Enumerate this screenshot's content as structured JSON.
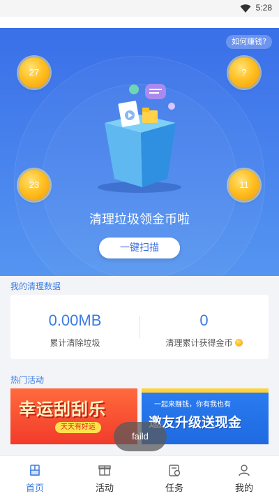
{
  "status_bar": {
    "time": "5:28"
  },
  "hero": {
    "how_to_earn": "如何赚钱?",
    "coins": [
      "27",
      "?",
      "23",
      "11"
    ],
    "title": "清理垃圾领金币啦",
    "scan_button": "一键扫描"
  },
  "cleanup": {
    "section_title": "我的清理数据",
    "cleared_value": "0.00MB",
    "cleared_label": "累计清除垃圾",
    "coins_value": "0",
    "coins_label": "清理累计获得金币"
  },
  "activities": {
    "section_title": "热门活动",
    "banners": [
      {
        "title": "幸运刮刮乐",
        "subtitle": "天天有好运"
      },
      {
        "title": "邀友升级送现金",
        "subtitle": "一起来赚钱，你有我也有"
      }
    ]
  },
  "toast": "faild",
  "tabs": [
    {
      "label": "首页",
      "icon": "broom-icon",
      "active": true
    },
    {
      "label": "活动",
      "icon": "gift-icon",
      "active": false
    },
    {
      "label": "任务",
      "icon": "task-icon",
      "active": false
    },
    {
      "label": "我的",
      "icon": "user-icon",
      "active": false
    }
  ],
  "colors": {
    "accent": "#3a7be0",
    "hero_top": "#3a6fe8",
    "coin": "#ffc022"
  }
}
